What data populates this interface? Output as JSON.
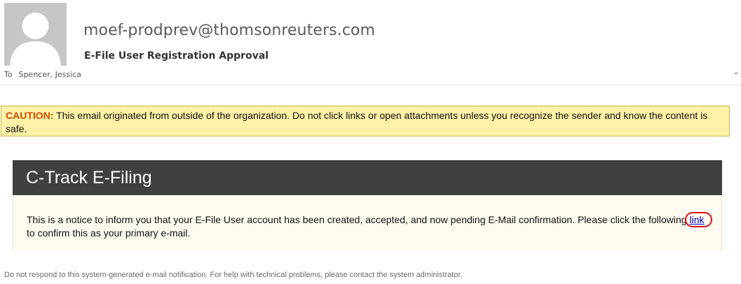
{
  "email": {
    "sender": "moef-prodprev@thomsonreuters.com",
    "subject": "E-File User Registration Approval",
    "to_label": "To",
    "to_recipient": "Spencer, Jessica"
  },
  "caution": {
    "title": "CAUTION:",
    "message": "This email originated from outside of the organization. Do not click links or open attachments unless you recognize the sender and know the content is safe."
  },
  "ctrack": {
    "heading": "C-Track E-Filing",
    "body_before_link": "This is a notice to inform you that your E-File User account has been created, accepted, and now pending E-Mail confirmation. Please click the following ",
    "link_text": "link",
    "body_after_link": " to confirm this as your primary e-mail."
  },
  "footer": {
    "text": "Do not respond to this system-generated e-mail notification. For help with technical problems, please contact the system administrator."
  },
  "colors": {
    "caution_background": "#fff2a8",
    "caution_title": "#d04a00",
    "ctrack_header_background": "#404040",
    "link_highlight": "#d8141c"
  }
}
